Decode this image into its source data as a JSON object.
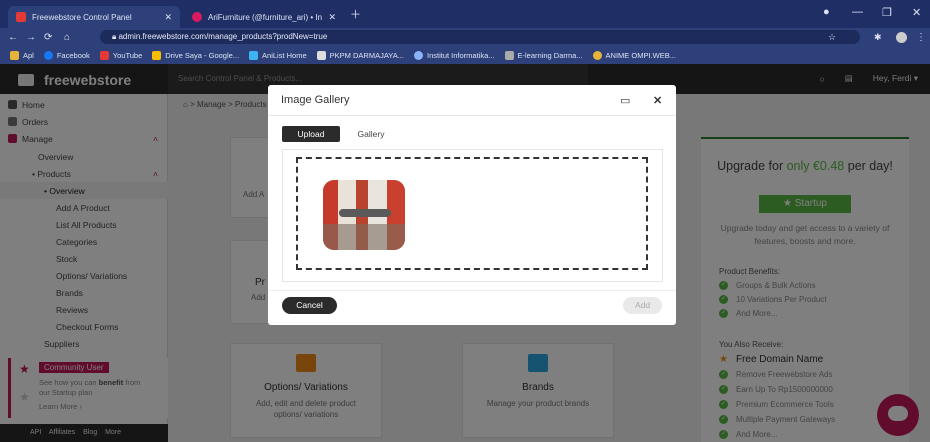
{
  "browser": {
    "tabs": [
      {
        "title": "Freewebstore Control Panel",
        "active": true
      },
      {
        "title": "AriFurniture (@furniture_ari) • In",
        "active": false
      }
    ],
    "url": "admin.freewebstore.com/manage_products?prodNew=true",
    "bookmarks": [
      "Apl",
      "Facebook",
      "YouTube",
      "Drive Saya - Google...",
      "AniList Home",
      "PKPM DARMAJAYA...",
      "Institut Informatika...",
      "E-learning Darma...",
      "ANIME OMPI.WEB..."
    ]
  },
  "app": {
    "logo": "freewebstore",
    "search_placeholder": "Search Control Panel & Products...",
    "user": "Hey, Ferdi"
  },
  "sidebar": {
    "items": [
      {
        "label": "Home"
      },
      {
        "label": "Orders"
      },
      {
        "label": "Manage"
      },
      {
        "label": "Overview"
      },
      {
        "label": "Products"
      },
      {
        "label": "Overview"
      },
      {
        "label": "Add A Product"
      },
      {
        "label": "List All Products"
      },
      {
        "label": "Categories"
      },
      {
        "label": "Stock"
      },
      {
        "label": "Options/ Variations"
      },
      {
        "label": "Brands"
      },
      {
        "label": "Reviews"
      },
      {
        "label": "Checkout Forms"
      },
      {
        "label": "Suppliers"
      }
    ],
    "community": {
      "badge": "Community User",
      "text_a": "See how you can ",
      "text_b": "benefit",
      "text_c": " from",
      "text_d": "our Startup plan",
      "learn_more": "Learn More"
    },
    "footer": "API Affiliates Blog More"
  },
  "main": {
    "breadcrumb": "> Manage > Products",
    "cards": {
      "add_fragment": "Add A",
      "pr_fragment": "Pr",
      "add2_fragment": "Add",
      "options_title": "Options/ Variations",
      "options_desc": "Add, edit and delete product options/ variations",
      "brands_title": "Brands",
      "brands_desc": "Manage your product brands"
    }
  },
  "upgrade": {
    "title_a": "Upgrade for ",
    "title_b": "only €0.48",
    "title_c": " per day!",
    "plan": "★ Startup",
    "desc": "Upgrade today and get access to a variety of features, boosts and more.",
    "benefits_label": "Product Benefits:",
    "benefits": [
      "Groups & Bulk Actions",
      "10 Variations Per Product",
      "And More..."
    ],
    "receive_label": "You Also Receive:",
    "domain": "Free Domain Name",
    "receive": [
      "Remove Freewebstore Ads",
      "Earn Up To Rp1500000000",
      "Premium Ecommerce Tools",
      "Multiple Payment Gateways",
      "And More..."
    ]
  },
  "modal": {
    "title": "Image Gallery",
    "tab_upload": "Upload",
    "tab_gallery": "Gallery",
    "cancel": "Cancel",
    "add": "Add"
  },
  "colors": {
    "accent": "#58b944",
    "brand_pink": "#c2185b",
    "dark": "#2b2b2b"
  }
}
